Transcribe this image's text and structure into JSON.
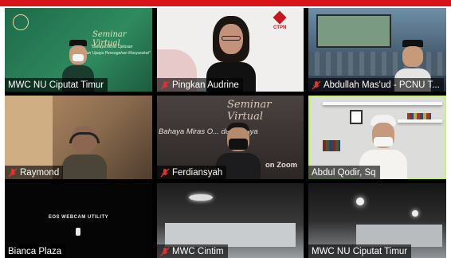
{
  "app": {
    "accent": "#d8141b",
    "active_speaker_border": "#c6f46a",
    "muted_mic_color": "#e0332e"
  },
  "tiles": [
    {
      "name": "MWC NU Ciputat Timur",
      "muted": false
    },
    {
      "name": "Pingkan Audrine",
      "muted": true
    },
    {
      "name": "Abdullah Mas'ud - PCNU T...",
      "muted": true
    },
    {
      "name": "Raymond",
      "muted": true
    },
    {
      "name": "Ferdiansyah",
      "muted": true
    },
    {
      "name": "Abdul Qodir, Sq",
      "muted": false
    },
    {
      "name": "Bianca Plaza",
      "muted": false
    },
    {
      "name": "MWC Cintim",
      "muted": true
    },
    {
      "name": "MWC NU Ciputat Timur",
      "muted": false
    }
  ],
  "content": {
    "seminar_title": "Seminar Virtual",
    "seminar_sub1": "\"Bahaya Miras Oplosan",
    "seminar_sub2": "dan Upaya Pencegahan Masyarakat\"",
    "ferdi_banner": "Bahaya Miras O... dan Upaya",
    "ferdi_zoom": "on Zoom",
    "eos_text": "EOS WEBCAM UTILITY",
    "ctpn_logo": "CTPN"
  }
}
